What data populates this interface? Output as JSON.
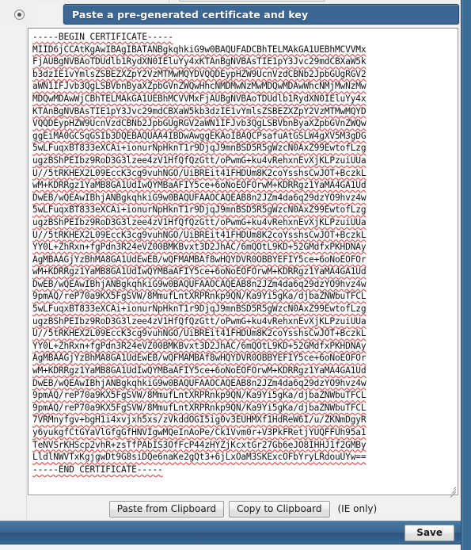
{
  "section": {
    "radio_selected": true,
    "radio_name": "paste-certificate-option",
    "title": "Paste a pre-generated certificate and key"
  },
  "certificate": {
    "placeholder": "",
    "begin_line": "-----BEGIN CERTIFICATE-----",
    "end_line": "-----END CERTIFICATE-----",
    "value": "-----BEGIN CERTIFICATE-----\nMIID6jCCAtKgAwIBAgIBATANBgkqhkiG9w0BAQUFADCBhTELMAkGA1UEBhMCVVMx\nFjAUBgNVBAoTDUdlb1RydXN0IEluYy4xKTAnBgNVBAsTIE1pY3Jvc29mdCBXaW5k\nb3dzIE1vYmlsZSBEZXZpY2VzMTMwMQYDVQQDEypHZW9UcnVzdCBNb2JpbGUgRGV2\naWN1IFJvb3QgLSBVbnByaXZpbGVnZWQwHhcNMDMwNzMwMDQwMDAwWhcNMjMwNzMw\nMDQwMDAwWjCBhTELMAkGA1UEBhMCVVMxFjAUBgNVBAoTDUdlb1RydXN0IEluYy4x\nKTAnBgNVBAsTIE1pY3Jvc29mdCBXaW5kb3dzIE1vYmlsZSBEZXZpY2VzMTMwMQYD\nVQQDEypHZW9UcnVzdCBNb2JpbGUgRGV2aWN1IFJvb3QgLSBVbnByaXZpbGVnZWQw\nggEiMA0GCSqGSIb3DQEBAQUAA4IBDwAwggEKAoIBAQCPsafuAtGSLW4gXV5M3gDG\n5wLFuqxBT833eXCAi+ionurNpHknT1r9DjqJ9mnBSD5R5gWzcN0AxZ99EwtofLzg\nugzBShPEIbz9RoD3G3lzee4zV1HfQfQzGtt/oPwmG+ku4vRehxnEvXjKLPzuiUUa\nU//5tRKHEX2L09EccK3cg9vuhNGO/UiBREit41FHDUm8K2coYsshsCwJOT+BczkL\nwM+KDRRgz1YaMB8GA1UdIwQYMBaAFIY5ce+6oNoEOFOrwM+KDRRgz1YaMA4GA1Ud\nDwEB/wQEAwIBhjANBgkqhkiG9w0BAQUFAAOCAQEAB8n2JZm4da6q29dzYO9hvz4w\n5wLFuqxBT833eXCAi+ionurNpHknT1r9DjqJ9mnBSD5R5gWzcN0AxZ99EwtofLzg\nugzBShPEIbz9RoD3G3lzee4zV1HfQfQzGtt/oPwmG+ku4vRehxnEvXjKLPzuiUUa\nU//5tRKHEX2L09EccK3cg9vuhNGO/UiBREit41FHDUm8K2coYsshsCwJOT+BczkL\nYY0L+ZhRxn+fgPdn3R24eVZ00BMKBvxt3D2JhAC/6mQOtL9KD+52GMdfxPKHDNAy\nAgMBAAGjYzBhMA8GA1UdEwEB/wQFMAMBAf8wHQYDVR0OBBYEFIY5ce+6oNoEOFOr\nwM+KDRRgz1YaMB8GA1UdIwQYMBaAFIY5ce+6oNoEOFOrwM+KDRRgz1YaMA4GA1Ud\nDwEB/wQEAwIBhjANBgkqhkiG9w0BAQUFAAOCAQEAB8n2JZm4da6q29dzYO9hvz4w\n9pmAQ/reP70a9KX5FgSVW/8MmufLntXRPRnkp9QN/Ka9Yi5gKa/djbaZNWbuTFCL\n5wLFuqxBT833eXCAi+ionurNpHknT1r9DjqJ9mnBSD5R5gWzcN0AxZ99EwtofLzg\nugzBShPEIbz9RoD3G3lzee4zV1HfQfQzGtt/oPwmG+ku4vRehxnEvXjKLPzuiUUa\nU//5tRKHEX2L09EccK3cg9vuhNGO/UiBREit41FHDUm8K2coYsshsCwJOT+BczkL\nYY0L+ZhRxn+fgPdn3R24eVZ00BMKBvxt3D2JhAC/6mQOtL9KD+52GMdfxPKHDNAy\nAgMBAAGjYzBhMA8GA1UdEwEB/wQFMAMBAf8wHQYDVR0OBBYEFIY5ce+6oNoEOFOr\nwM+KDRRgz1YaMB8GA1UdIwQYMBaAFIY5ce+6oNoEOFOrwM+KDRRgz1YaMA4GA1Ud\nDwEB/wQEAwIBhjANBgkqhkiG9w0BAQUFAAOCAQEAB8n2JZm4da6q29dzYO9hvz4w\n9pmAQ/reP70a9KX5FgSVW/8MmufLntXRPRnkp9QN/Ka9Yi5gKa/djbaZNWbuTFCL\n9pmAQ/reP70a9KX5FgSVW/8MmufLntXRPRnkp9QN/Ka9Yi5gKa/djbaZNWbuTFCL\n7VRMnyfgv+bgH1i4xvjxh5xs/zVkddOGI5ig0v3EUHMXf1HdReW6I/u/ZKNmDgyR\ny6yukgfCtGYaVlGfgGfHNVIgwMQeInAoPe/Ck1Vvm0r+V3PkFRetjYUQFFUh95a1\nTeNVSrKHScp2vhR+zsTfPAbIS3OfFcP44zHYZjKcxtGr27Gb6eJO8IHHJ1f2GMBy\nLldlNWVTxKgjgwDt9G8siDQe6naKe2gQt3+6jLxOaM3SKExcOFbYryLRdouUYw==\n-----END CERTIFICATE-----"
  },
  "actions": {
    "paste_label": "Paste from Clipboard",
    "copy_label": "Copy to Clipboard",
    "note": "(IE only)"
  },
  "footer": {
    "save_label": "Save"
  },
  "colors": {
    "header_blue": "#3a6793",
    "header_blue_dark": "#2e557e",
    "page_bg": "#f2f1ef",
    "spellcheck_red": "#e24b4b",
    "button_face": "#eeeeee"
  }
}
